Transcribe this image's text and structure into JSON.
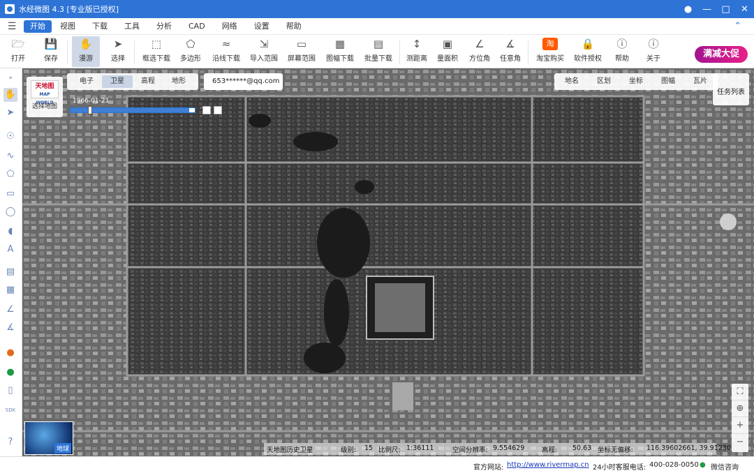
{
  "window": {
    "title": "水经微图 4.3 [专业版已授权]"
  },
  "menu": {
    "items": [
      "开始",
      "视图",
      "下载",
      "工具",
      "分析",
      "CAD",
      "网络",
      "设置",
      "帮助"
    ]
  },
  "toolbar": {
    "open": "打开",
    "save": "保存",
    "roam": "漫游",
    "select": "选择",
    "box_download": "框选下载",
    "polygon": "多边形",
    "line_download": "沿线下载",
    "import_range": "导入范围",
    "screen_range": "屏幕范围",
    "sheet_download": "图幅下载",
    "batch_download": "批量下载",
    "measure_distance": "测距离",
    "measure_area": "量面积",
    "azimuth": "方位角",
    "any_angle": "任意角",
    "taobao": "淘宝购买",
    "license": "软件授权",
    "help": "帮助",
    "about": "关于",
    "promo": "满减大促"
  },
  "map": {
    "tabs": [
      "电子",
      "卫星",
      "高程",
      "地形"
    ],
    "selected_tab": "卫星",
    "email": "653******@qq.com",
    "right_tabs": [
      "地名",
      "区划",
      "坐标",
      "图幅",
      "瓦片"
    ],
    "task_list": "任务列表",
    "logo_text": "天地图",
    "logo_sub": "MAP WORLD",
    "select_map": "选择地图",
    "timeline_date": "1966-01-21",
    "globe_label": "地球",
    "info": {
      "source": "天地图历史卫星",
      "level_label": "级别:",
      "level": "15",
      "scale_label": "比例尺:",
      "scale": "1:36111",
      "resolution_label": "空间分辨率:",
      "resolution": "9.554629",
      "elevation_label": "高程:",
      "elevation": "50.63",
      "offset_label": "坐标无偏移:",
      "coords": "116.39602661, 39.91230011"
    }
  },
  "status": {
    "website_label": "官方网站:",
    "website": "http://www.rivermap.cn",
    "hotline_label": "24小时客服电话:",
    "hotline": "400-028-0050",
    "wechat": "微信咨询"
  }
}
